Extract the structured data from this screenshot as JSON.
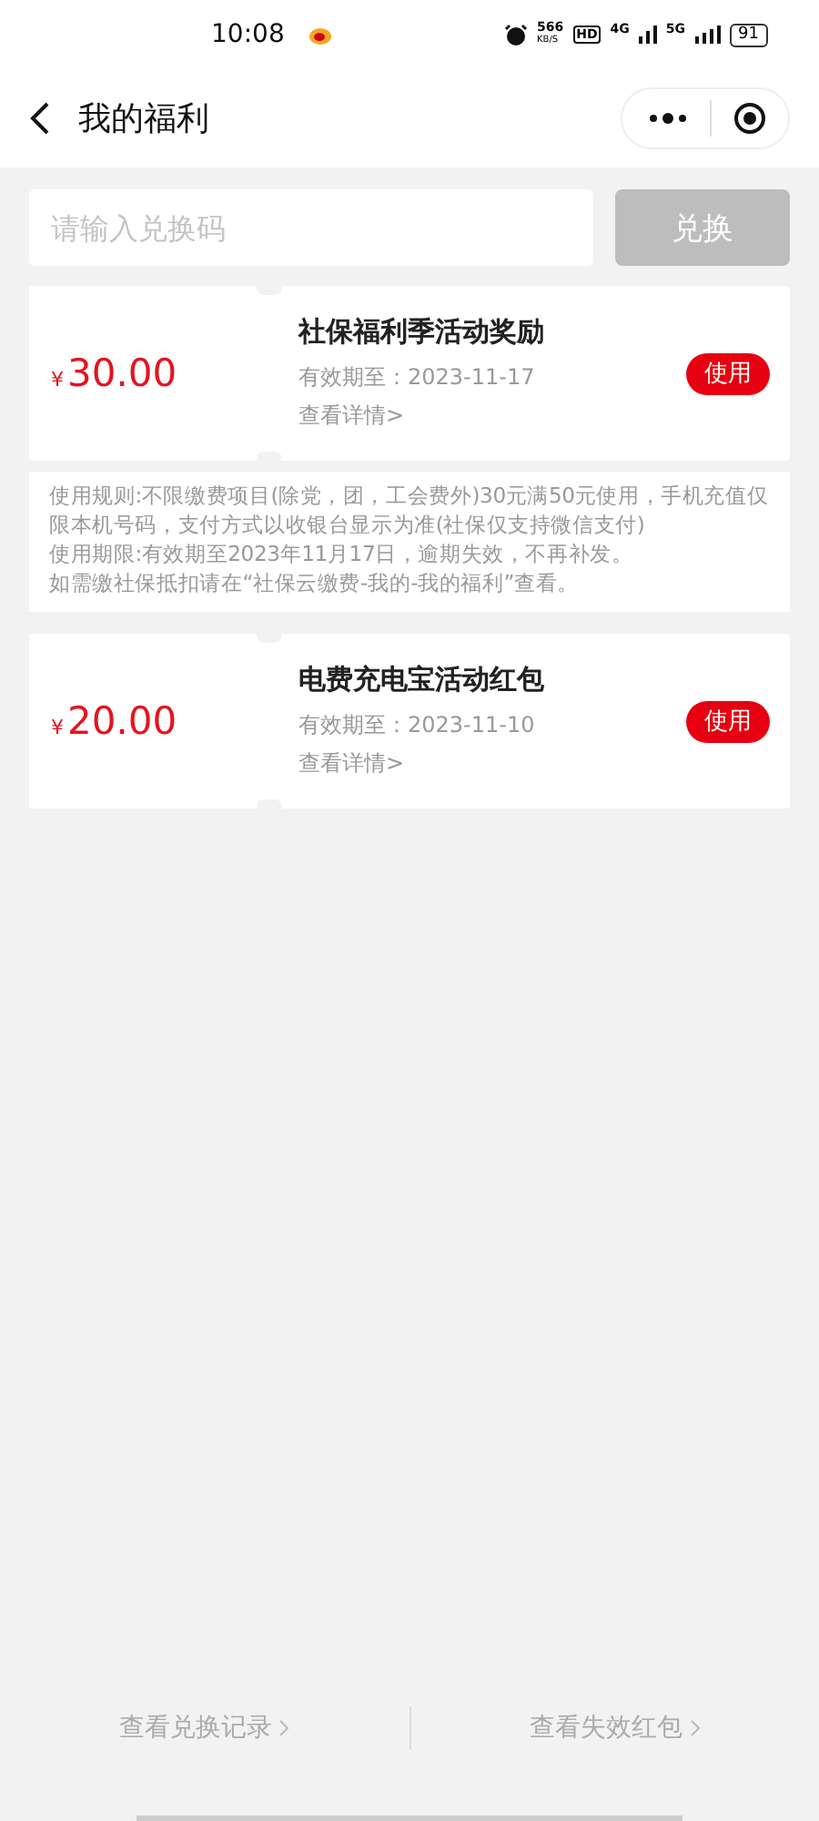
{
  "status_bar": {
    "time": "10:08",
    "network_speed": "566",
    "network_unit": "KB/S",
    "hd": "HD",
    "net_4g": "4G",
    "net_5g": "5G",
    "battery": "91"
  },
  "nav": {
    "title": "我的福利"
  },
  "redeem": {
    "placeholder": "请输入兑换码",
    "button": "兑换",
    "disabled": true
  },
  "coupons": [
    {
      "currency": "¥",
      "amount": "30.00",
      "title": "社保福利季活动奖励",
      "expiry_label": "有效期至：",
      "expiry": "2023-11-17",
      "details": "查看详情>",
      "action": "使用",
      "rules": [
        "使用规则:不限缴费项目(除党，团，工会费外)30元满50元使用，手机充值仅限本机号码，支付方式以收银台显示为准(社保仅支持微信支付)",
        "使用期限:有效期至2023年11月17日，逾期失效，不再补发。",
        "如需缴社保抵扣请在“社保云缴费-我的-我的福利”查看。"
      ]
    },
    {
      "currency": "¥",
      "amount": "20.00",
      "title": "电费充电宝活动红包",
      "expiry_label": "有效期至：",
      "expiry": "2023-11-10",
      "details": "查看详情>",
      "action": "使用"
    }
  ],
  "footer": {
    "left": "查看兑换记录",
    "right": "查看失效红包"
  }
}
